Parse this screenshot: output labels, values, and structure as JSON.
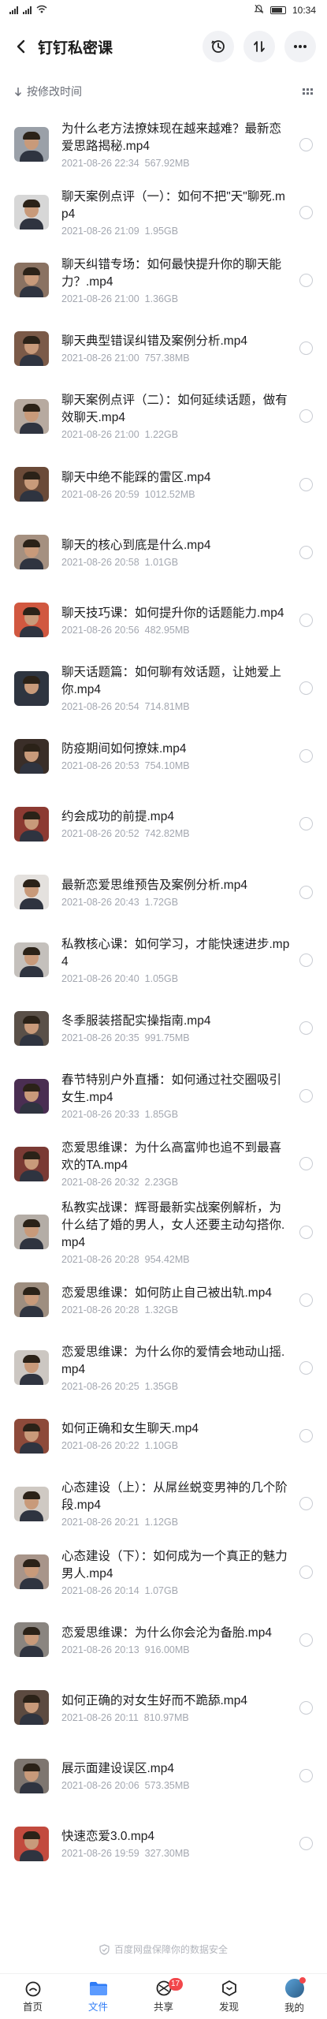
{
  "status": {
    "time": "10:34",
    "battery": "49"
  },
  "header": {
    "title": "钉钉私密课"
  },
  "sort": {
    "label": "按修改时间"
  },
  "files": [
    {
      "name": "为什么老方法撩妹现在越来越难？最新恋爱思路揭秘.mp4",
      "date": "2021-08-26 22:34",
      "size": "567.92MB",
      "thumb": "#9aa0a8"
    },
    {
      "name": "聊天案例点评（一）：如何不把\"天\"聊死.mp4",
      "date": "2021-08-26 21:09",
      "size": "1.95GB",
      "thumb": "#d7d7d7"
    },
    {
      "name": "聊天纠错专场：如何最快提升你的聊天能力？.mp4",
      "date": "2021-08-26 21:00",
      "size": "1.36GB",
      "thumb": "#8a7262"
    },
    {
      "name": "聊天典型错误纠错及案例分析.mp4",
      "date": "2021-08-26 21:00",
      "size": "757.38MB",
      "thumb": "#7b5a48"
    },
    {
      "name": "聊天案例点评（二）：如何延续话题，做有效聊天.mp4",
      "date": "2021-08-26 21:00",
      "size": "1.22GB",
      "thumb": "#b7aaa0"
    },
    {
      "name": "聊天中绝不能踩的雷区.mp4",
      "date": "2021-08-26 20:59",
      "size": "1012.52MB",
      "thumb": "#6a4a38"
    },
    {
      "name": "聊天的核心到底是什么.mp4",
      "date": "2021-08-26 20:58",
      "size": "1.01GB",
      "thumb": "#a59080"
    },
    {
      "name": "聊天技巧课：如何提升你的话题能力.mp4",
      "date": "2021-08-26 20:56",
      "size": "482.95MB",
      "thumb": "#d15840"
    },
    {
      "name": "聊天话题篇：如何聊有效话题，让她爱上你.mp4",
      "date": "2021-08-26 20:54",
      "size": "714.81MB",
      "thumb": "#2e3540"
    },
    {
      "name": "防疫期间如何撩妹.mp4",
      "date": "2021-08-26 20:53",
      "size": "754.10MB",
      "thumb": "#3a2e28"
    },
    {
      "name": "约会成功的前提.mp4",
      "date": "2021-08-26 20:52",
      "size": "742.82MB",
      "thumb": "#8c3a32"
    },
    {
      "name": "最新恋爱思维预告及案例分析.mp4",
      "date": "2021-08-26 20:43",
      "size": "1.72GB",
      "thumb": "#e4e1de"
    },
    {
      "name": "私教核心课：如何学习，才能快速进步.mp4",
      "date": "2021-08-26 20:40",
      "size": "1.05GB",
      "thumb": "#c4c0bc"
    },
    {
      "name": "冬季服装搭配实操指南.mp4",
      "date": "2021-08-26 20:35",
      "size": "991.75MB",
      "thumb": "#5a5048"
    },
    {
      "name": "春节特别户外直播：如何通过社交圈吸引女生.mp4",
      "date": "2021-08-26 20:33",
      "size": "1.85GB",
      "thumb": "#4a2e52"
    },
    {
      "name": "恋爱思维课：为什么高富帅也追不到最喜欢的TA.mp4",
      "date": "2021-08-26 20:32",
      "size": "2.23GB",
      "thumb": "#7a3a34"
    },
    {
      "name": "私教实战课：辉哥最新实战案例解析，为什么结了婚的男人，女人还要主动勾搭你.mp4",
      "date": "2021-08-26 20:28",
      "size": "954.42MB",
      "thumb": "#b4ada6"
    },
    {
      "name": "恋爱思维课：如何防止自己被出轨.mp4",
      "date": "2021-08-26 20:28",
      "size": "1.32GB",
      "thumb": "#9e8e80"
    },
    {
      "name": "恋爱思维课：为什么你的爱情会地动山摇.mp4",
      "date": "2021-08-26 20:25",
      "size": "1.35GB",
      "thumb": "#ccc7c2"
    },
    {
      "name": "如何正确和女生聊天.mp4",
      "date": "2021-08-26 20:22",
      "size": "1.10GB",
      "thumb": "#8d4a3a"
    },
    {
      "name": "心态建设（上）：从屌丝蜕变男神的几个阶段.mp4",
      "date": "2021-08-26 20:21",
      "size": "1.12GB",
      "thumb": "#cfc9c3"
    },
    {
      "name": "心态建设（下）：如何成为一个真正的魅力男人.mp4",
      "date": "2021-08-26 20:14",
      "size": "1.07GB",
      "thumb": "#a8958a"
    },
    {
      "name": "恋爱思维课：为什么你会沦为备胎.mp4",
      "date": "2021-08-26 20:13",
      "size": "916.00MB",
      "thumb": "#8a8580"
    },
    {
      "name": "如何正确的对女生好而不跪舔.mp4",
      "date": "2021-08-26 20:11",
      "size": "810.97MB",
      "thumb": "#5c4a40"
    },
    {
      "name": "展示面建设误区.mp4",
      "date": "2021-08-26 20:06",
      "size": "573.35MB",
      "thumb": "#7e7670"
    },
    {
      "name": "快速恋爱3.0.mp4",
      "date": "2021-08-26 19:59",
      "size": "327.30MB",
      "thumb": "#c24a3e"
    }
  ],
  "footer": {
    "safe_text": "百度网盘保障你的数据安全"
  },
  "tabs": [
    {
      "label": "首页",
      "icon": "home-icon"
    },
    {
      "label": "文件",
      "icon": "folder-icon"
    },
    {
      "label": "共享",
      "icon": "share-icon",
      "badge": "17"
    },
    {
      "label": "发现",
      "icon": "discover-icon"
    },
    {
      "label": "我的",
      "icon": "profile-icon"
    }
  ],
  "colors": {
    "accent": "#2f7cf6",
    "badge": "#f2474b",
    "meta": "#a3a7b0"
  }
}
